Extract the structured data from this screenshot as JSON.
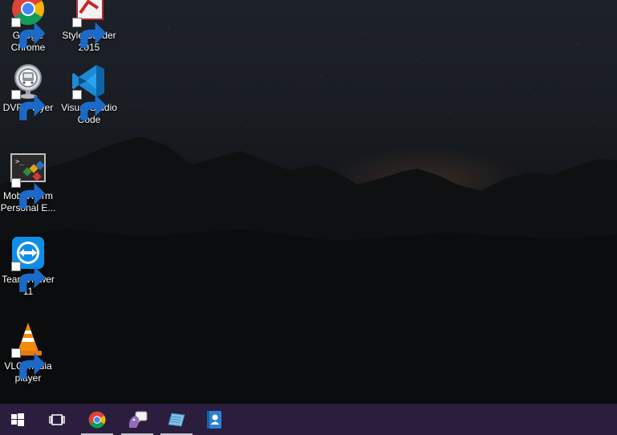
{
  "desktop": {
    "icons": [
      {
        "label": "Google\nChrome",
        "icon": "chrome-icon"
      },
      {
        "label": "Style Builder\n2015",
        "icon": "style-builder-icon"
      },
      {
        "label": "DVR Player",
        "icon": "dvr-player-icon"
      },
      {
        "label": "Visual Studio\nCode",
        "icon": "vscode-icon"
      },
      {
        "label": "MobaXterm\nPersonal E...",
        "icon": "mobaxterm-icon"
      },
      {
        "label": "TeamViewer\n11",
        "icon": "teamviewer-icon"
      },
      {
        "label": "VLC media\nplayer",
        "icon": "vlc-icon"
      }
    ]
  },
  "taskbar": {
    "background": "#2a1d3e",
    "items": [
      {
        "icon": "windows-start-icon",
        "running": false
      },
      {
        "icon": "task-view-icon",
        "running": false
      },
      {
        "icon": "chrome-icon",
        "running": true
      },
      {
        "icon": "pidgin-icon",
        "running": true
      },
      {
        "icon": "notepad-icon",
        "running": true
      },
      {
        "icon": "contacts-icon",
        "running": false
      }
    ]
  }
}
